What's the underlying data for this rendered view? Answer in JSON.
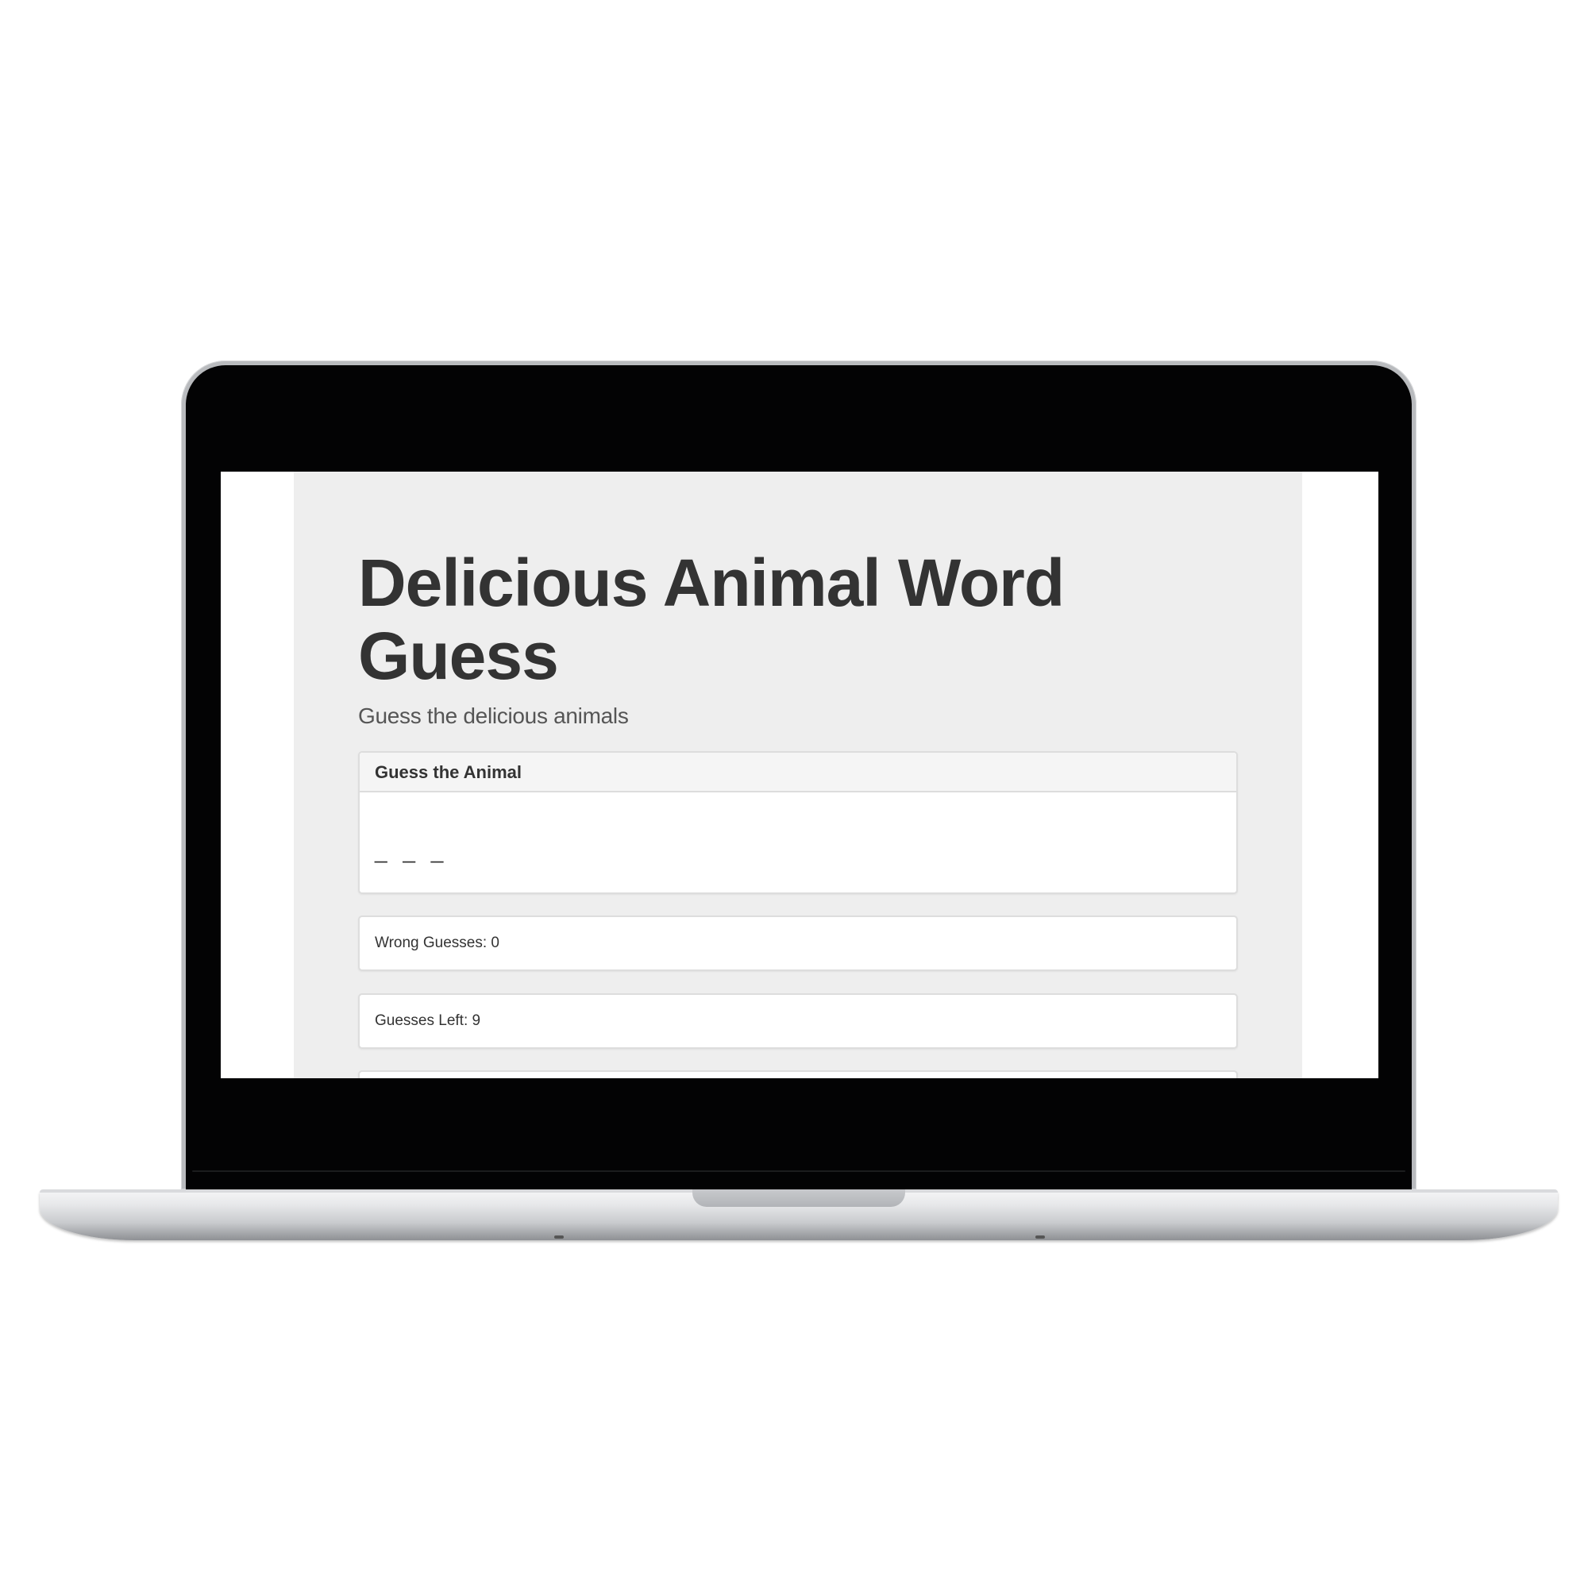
{
  "app": {
    "title": "Delicious Animal Word Guess",
    "subtitle": "Guess the delicious animals"
  },
  "panels": {
    "guess": {
      "heading": "Guess the Animal",
      "word_display": "_ _ _"
    },
    "wrong_guesses": {
      "text": "Wrong Guesses: 0"
    },
    "guesses_left": {
      "text": "Guesses Left: 9"
    }
  },
  "colors": {
    "jumbotron_bg": "#eeeeee",
    "panel_heading_bg": "#f5f5f5",
    "text": "#333333",
    "bezel": "#030304"
  }
}
